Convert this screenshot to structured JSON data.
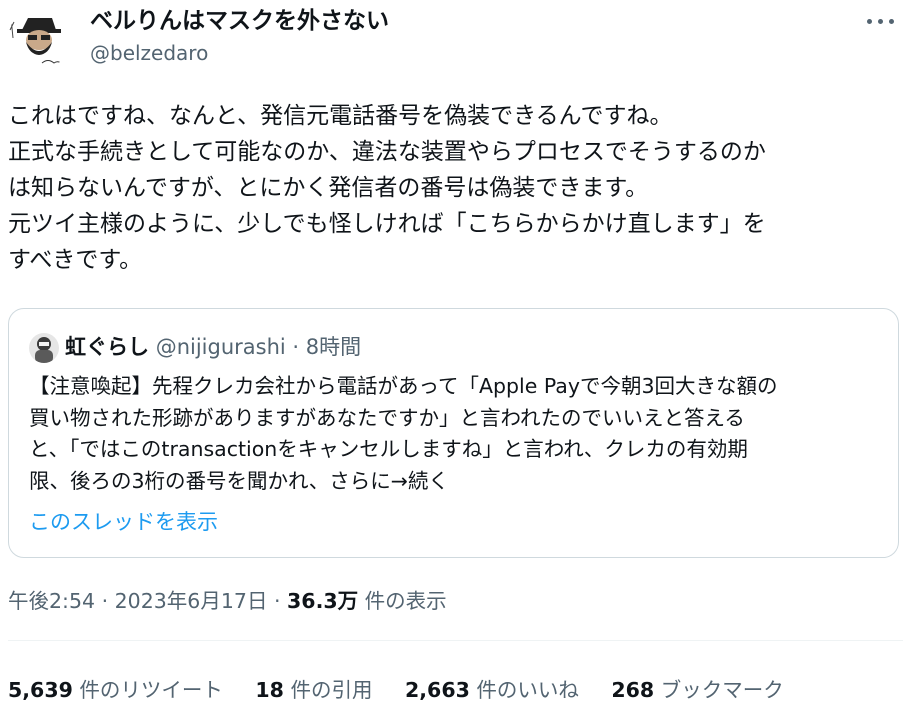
{
  "author": {
    "display_name": "ベルりんはマスクを外さない",
    "handle": "@belzedaro"
  },
  "tweet": {
    "lines": [
      "これはですね、なんと、発信元電話番号を偽装できるんですね。",
      "正式な手続きとして可能なのか、違法な装置やらプロセスでそうするのか",
      "は知らないんですが、とにかく発信者の番号は偽装できます。",
      "元ツイ主様のように、少しでも怪しければ「こちらからかけ直します」を",
      "すべきです。"
    ]
  },
  "quoted_tweet": {
    "display_name": "虹ぐらし",
    "handle": "@nijigurashi",
    "separator": "·",
    "time": "8時間",
    "lines": [
      "【注意喚起】先程クレカ会社から電話があって「Apple Payで今朝3回大きな額の",
      "買い物された形跡がありますがあなたですか」と言われたのでいいえと答える",
      "と、「ではこのtransactionをキャンセルしますね」と言われ、クレカの有効期",
      "限、後ろの3桁の番号を聞かれ、さらに→続く"
    ],
    "show_thread_label": "このスレッドを表示"
  },
  "meta": {
    "time": "午後2:54",
    "separator": "·",
    "date": "2023年6月17日",
    "views_count": "36.3万",
    "views_label": "件の表示"
  },
  "stats": {
    "retweets": {
      "count": "5,639",
      "label": "件のリツイート"
    },
    "quotes": {
      "count": "18",
      "label": "件の引用"
    },
    "likes": {
      "count": "2,663",
      "label": "件のいいね"
    },
    "bookmarks": {
      "count": "268",
      "label": "ブックマーク"
    }
  },
  "colors": {
    "text": "#0f1419",
    "secondary": "#536471",
    "link": "#1d9bf0",
    "border": "#cfd9de"
  },
  "icons": {
    "more": "more-horizontal-icon"
  }
}
